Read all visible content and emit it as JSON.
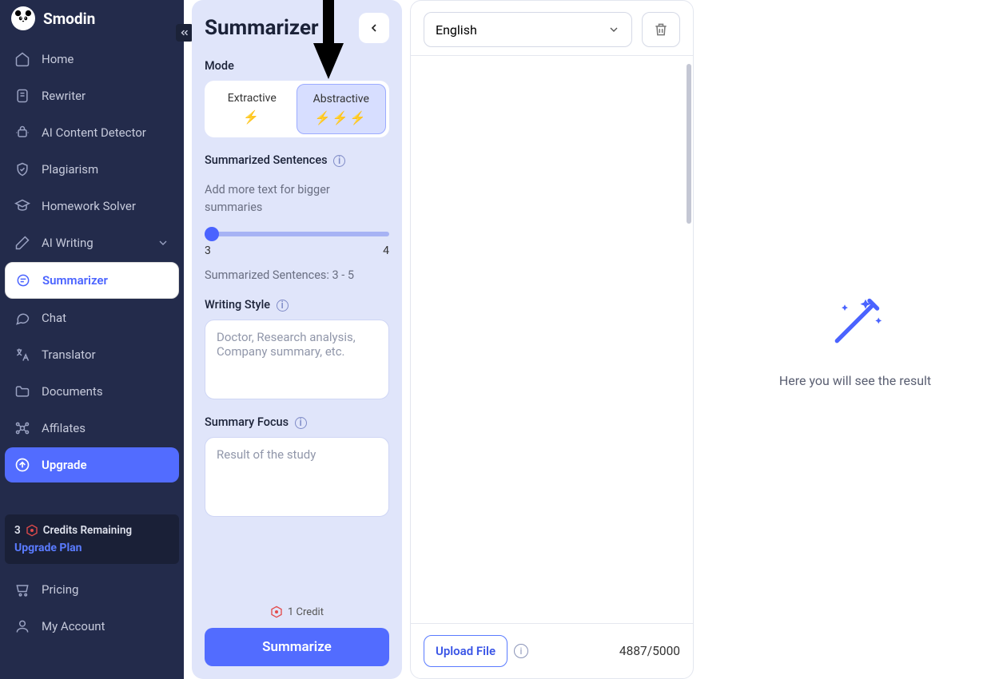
{
  "brand": {
    "name": "Smodin"
  },
  "sidebar": {
    "items": [
      {
        "label": "Home",
        "icon": "home-icon"
      },
      {
        "label": "Rewriter",
        "icon": "rewriter-icon"
      },
      {
        "label": "AI Content Detector",
        "icon": "detector-icon"
      },
      {
        "label": "Plagiarism",
        "icon": "shield-icon"
      },
      {
        "label": "Homework Solver",
        "icon": "homework-icon"
      },
      {
        "label": "AI Writing",
        "icon": "writing-icon",
        "expandable": true
      },
      {
        "label": "Summarizer",
        "icon": "summarizer-icon",
        "active": true
      },
      {
        "label": "Chat",
        "icon": "chat-icon"
      },
      {
        "label": "Translator",
        "icon": "translate-icon"
      },
      {
        "label": "Documents",
        "icon": "folder-icon"
      },
      {
        "label": "Affilates",
        "icon": "affiliates-icon"
      },
      {
        "label": "Upgrade",
        "icon": "upgrade-icon",
        "upgrade": true
      }
    ],
    "credits": {
      "count": "3",
      "label": "Credits Remaining",
      "upgrade_label": "Upgrade Plan"
    },
    "bottom": [
      {
        "label": "Pricing",
        "icon": "cart-icon"
      },
      {
        "label": "My Account",
        "icon": "account-icon"
      }
    ]
  },
  "panel": {
    "title": "Summarizer",
    "mode_label": "Mode",
    "modes": [
      {
        "label": "Extractive",
        "bolts": "⚡"
      },
      {
        "label": "Abstractive",
        "bolts": "⚡⚡⚡",
        "selected": true
      }
    ],
    "sentences": {
      "title": "Summarized Sentences",
      "helper": "Add more text for bigger summaries",
      "min": "3",
      "max": "4",
      "readout": "Summarized Sentences: 3 - 5"
    },
    "writing_style": {
      "title": "Writing Style",
      "placeholder": "Doctor, Research analysis, Company summary, etc."
    },
    "summary_focus": {
      "title": "Summary Focus",
      "placeholder": "Result of the study"
    },
    "credit_line": "1 Credit",
    "summarize_label": "Summarize"
  },
  "input": {
    "language": "English",
    "upload_label": "Upload File",
    "char_count": "4887/5000"
  },
  "result": {
    "placeholder": "Here you will see the result"
  }
}
